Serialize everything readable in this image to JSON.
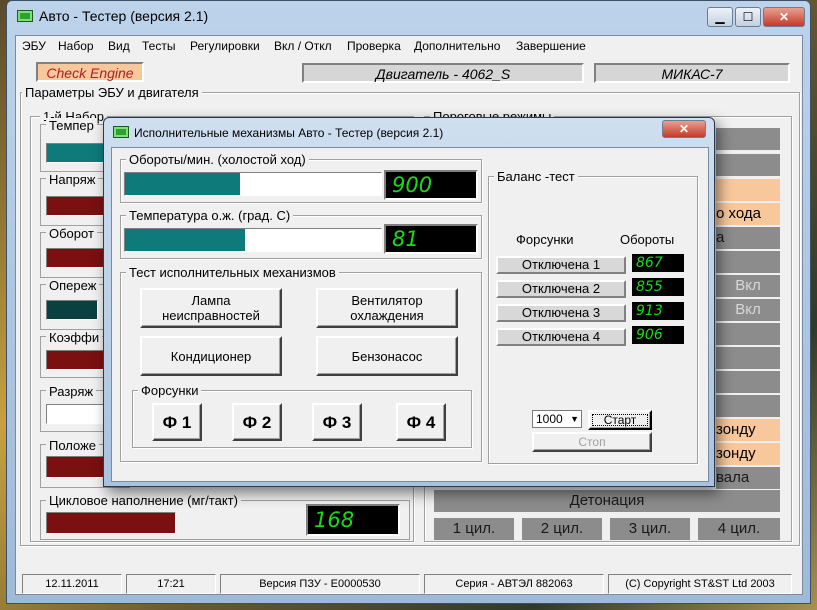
{
  "main": {
    "title": "Авто - Тестер  (версия 2.1)",
    "controls": {
      "min": "▁",
      "max": "☐",
      "close": "✕"
    },
    "menu": [
      "ЭБУ",
      "Набор",
      "Вид",
      "Тесты",
      "Регулировки",
      "Вкл / Откл",
      "Проверка",
      "Дополнительно",
      "Завершение"
    ],
    "check_engine": "Check Engine",
    "engine": "Двигатель - 4062_S",
    "ecu": "МИКАС-7",
    "params_group": "Параметры ЭБУ и двигателя",
    "set1_group": "1-й  Набор",
    "set1_labels": [
      "Темпер",
      "Напряж",
      "Оборот",
      "Опереж",
      "Коэффи",
      "Разряж",
      "Положе"
    ],
    "cycle_fill_label": "Цикловое наполнение (мг/такт)",
    "cycle_fill_value": "168",
    "threshold_group": "Пороговые режимы",
    "right_texts": {
      "hod": "о хода",
      "a": "а",
      "vkl1": "Вкл",
      "vkl2": "Вкл",
      "zondu1": "зонду",
      "zondu2": "зонду",
      "vala": "вала"
    },
    "detonation": "Детонация",
    "cylinders": [
      "1 цил.",
      "2 цил.",
      "3 цил.",
      "4 цил."
    ],
    "status": {
      "date": "12.11.2011",
      "time": "17:21",
      "prom": "Версия ПЗУ - E0000530",
      "serial": "Серия - АВТЭЛ 882063",
      "copyright": "(C) Copyright   ST&ST  Ltd 2003"
    }
  },
  "dialog": {
    "title": "Исполнительные механизмы  Авто - Тестер  (версия 2.1)",
    "close": "✕",
    "rpm_label": "Обороты/мин. (холостой ход)",
    "rpm_value": "900",
    "rpm_fraction": 0.45,
    "temp_label": "Температура  о.ж.  (град. С)",
    "temp_value": "81",
    "temp_fraction": 0.47,
    "actuators_group": "Тест исполнительных механизмов",
    "actuator_buttons": [
      {
        "line1": "Лампа",
        "line2": "неисправностей"
      },
      {
        "line1": "Вентилятор",
        "line2": "охлаждения"
      },
      {
        "line1": "Кондиционер",
        "line2": ""
      },
      {
        "line1": "Бензонасос",
        "line2": ""
      }
    ],
    "injectors_group": "Форсунки",
    "injectors": [
      "Ф 1",
      "Ф 2",
      "Ф 3",
      "Ф 4"
    ],
    "balance_group": "Баланс -тест",
    "balance_col_injectors": "Форсунки",
    "balance_col_rpm": "Обороты",
    "balance_rows": [
      {
        "label": "Отключена   1",
        "rpm": "867"
      },
      {
        "label": "Отключена   2",
        "rpm": "855"
      },
      {
        "label": "Отключена   3",
        "rpm": "913"
      },
      {
        "label": "Отключена   4",
        "rpm": "906"
      }
    ],
    "speed_select": "1000",
    "start": "Старт",
    "stop": "Стоп"
  },
  "colors": {
    "bar_teal": "#0f7a7a",
    "bar_maroon": "#7a1010",
    "led_green": "#19d919",
    "peach": "#f8c89c"
  }
}
